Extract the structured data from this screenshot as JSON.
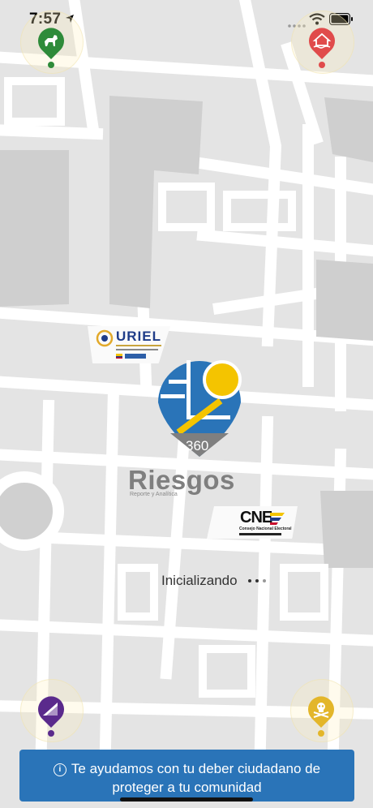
{
  "status_bar": {
    "time": "7:57",
    "icons": [
      "location-arrow-icon",
      "signal-icon",
      "wifi-icon",
      "battery-icon"
    ]
  },
  "map": {
    "pins": [
      {
        "name": "dog-icon",
        "color": "#2e8b3a"
      },
      {
        "name": "flood-house-icon",
        "color": "#e04b4b"
      },
      {
        "name": "landslide-icon",
        "color": "#5a2a8c"
      },
      {
        "name": "skull-crossbones-icon",
        "color": "#e3b62a"
      }
    ]
  },
  "logos": {
    "uriel": "URIEL",
    "cne": "CNE",
    "cne_subtitle": "Consejo Nacional Electoral"
  },
  "brand": {
    "badge": "360",
    "name": "Riesgos",
    "tagline": "Reporte y Analítica"
  },
  "loading": {
    "text": "Inicializando"
  },
  "banner": {
    "icon": "info-icon",
    "text": "Te ayudamos con tu deber ciudadano de proteger a tu comunidad"
  },
  "colors": {
    "brand_blue": "#2a74b8",
    "brand_yellow": "#f4c400",
    "map_road": "#ffffff",
    "map_block": "#e4e4e4",
    "map_dark_block": "#c8c8c8"
  }
}
